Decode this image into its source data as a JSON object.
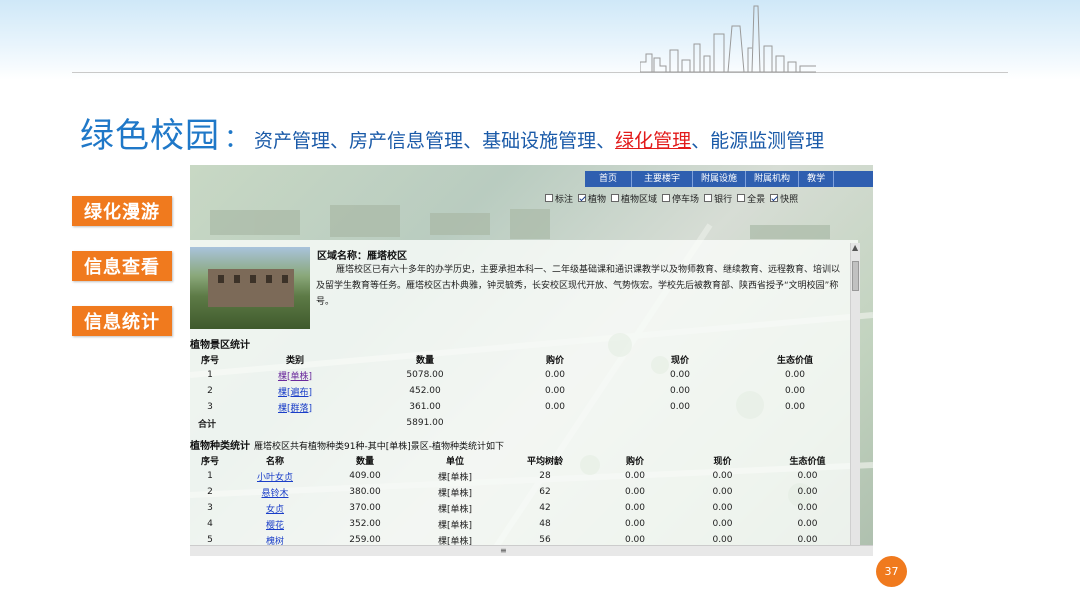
{
  "slide": {
    "title_main": "绿色校园",
    "title_colon": "：",
    "title_items": [
      "资产管理",
      "房产信息管理",
      "基础设施管理",
      "绿化管理",
      "能源监测管理"
    ],
    "title_separator": "、",
    "active_item": "绿化管理",
    "page_number": "37"
  },
  "side_buttons": [
    "绿化漫游",
    "信息查看",
    "信息统计"
  ],
  "app": {
    "nav": [
      "首页",
      "主要楼宇",
      "附属设施",
      "附属机构",
      "教学"
    ],
    "layers": [
      {
        "label": "标注",
        "checked": false
      },
      {
        "label": "植物",
        "checked": true
      },
      {
        "label": "植物区域",
        "checked": false
      },
      {
        "label": "停车场",
        "checked": false
      },
      {
        "label": "银行",
        "checked": false
      },
      {
        "label": "全景",
        "checked": false
      },
      {
        "label": "快照",
        "checked": true
      }
    ],
    "region_label": "区域名称：雁塔校区",
    "region_desc": "雁塔校区已有六十多年的办学历史，主要承担本科一、二年级基础课和通识课教学以及物师教育、继续教育、远程教育、培训以及留学生教育等任务。雁塔校区古朴典雅，钟灵毓秀，长安校区现代开放、气势恢宏。学校先后被教育部、陕西省授予“文明校园”称号。",
    "scenic_stats": {
      "title": "植物景区统计",
      "headers": [
        "序号",
        "类别",
        "数量",
        "购价",
        "现价",
        "生态价值"
      ],
      "rows": [
        [
          "1",
          "棵[单株]",
          "5078.00",
          "0.00",
          "0.00",
          "0.00"
        ],
        [
          "2",
          "棵[遍布]",
          "452.00",
          "0.00",
          "0.00",
          "0.00"
        ],
        [
          "3",
          "棵[群落]",
          "361.00",
          "0.00",
          "0.00",
          "0.00"
        ]
      ],
      "total_label": "合计",
      "total_value": "5891.00"
    },
    "species_stats": {
      "title": "植物种类统计",
      "note": "雁塔校区共有植物种类91种-其中[单株]景区-植物种类统计如下",
      "headers": [
        "序号",
        "名称",
        "数量",
        "单位",
        "平均树龄",
        "购价",
        "现价",
        "生态价值"
      ],
      "rows": [
        [
          "1",
          "小叶女贞",
          "409.00",
          "棵[单株]",
          "28",
          "0.00",
          "0.00",
          "0.00"
        ],
        [
          "2",
          "悬铃木",
          "380.00",
          "棵[单株]",
          "62",
          "0.00",
          "0.00",
          "0.00"
        ],
        [
          "3",
          "女贞",
          "370.00",
          "棵[单株]",
          "42",
          "0.00",
          "0.00",
          "0.00"
        ],
        [
          "4",
          "樱花",
          "352.00",
          "棵[单株]",
          "48",
          "0.00",
          "0.00",
          "0.00"
        ],
        [
          "5",
          "槐树",
          "259.00",
          "棵[单株]",
          "56",
          "0.00",
          "0.00",
          "0.00"
        ]
      ]
    }
  }
}
